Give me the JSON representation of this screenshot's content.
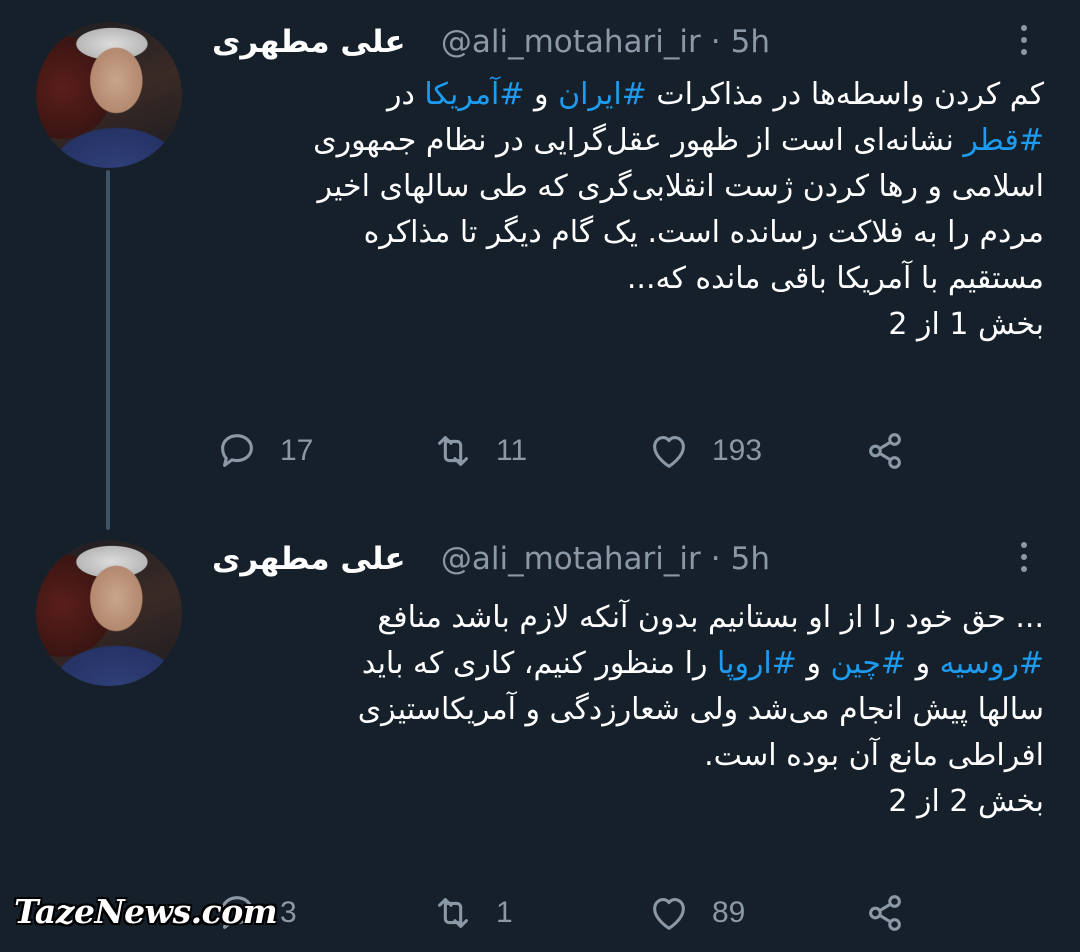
{
  "colors": {
    "background": "#15202b",
    "text": "#ffffff",
    "muted": "#8b98a5",
    "hashtag": "#1d9bf0"
  },
  "tweets": [
    {
      "name": "علی مطهری",
      "handle": "@ali_motahari_ir",
      "separator": "·",
      "time": "5h",
      "body": {
        "l1": {
          "a": "کم کردن واسطه‌ها در مذاکرات ",
          "t1": "#ایران",
          "b": " و ",
          "t2": "#آمریکا",
          "c": " در"
        },
        "l2": {
          "t1": "#قطر",
          "a": " نشانه‌ای است از ظهور عقل‌گرایی در نظام جمهوری"
        },
        "l3": "اسلامی و رها کردن ژست انقلابی‌گری که طی سالهای اخیر",
        "l4": "مردم را به فلاکت رسانده است. یک گام دیگر تا مذاکره",
        "l5": "مستقیم با آمریکا باقی مانده که...",
        "l6": "بخش 1 از 2"
      },
      "stats": {
        "replies": "17",
        "retweets": "11",
        "likes": "193"
      }
    },
    {
      "name": "علی مطهری",
      "handle": "@ali_motahari_ir",
      "separator": "·",
      "time": "5h",
      "body": {
        "l1": "... حق خود را از او بستانیم بدون آنکه لازم باشد منافع",
        "l2": {
          "t1": "#روسیه",
          "a": " و ",
          "t2": "#چین",
          "b": " و ",
          "t3": "#اروپا",
          "c": " را منظور کنیم، کاری که باید"
        },
        "l3": "سالها پیش انجام می‌شد ولی شعارزدگی و آمریکاستیزی",
        "l4": "افراطی مانع آن بوده است.",
        "l5": "بخش 2 از 2"
      },
      "stats": {
        "replies": "3",
        "retweets": "1",
        "likes": "89"
      }
    }
  ],
  "icons": {
    "reply": "reply-icon",
    "retweet": "retweet-icon",
    "like": "heart-icon",
    "share": "share-icon",
    "more": "more-vertical-icon"
  },
  "watermark": "TazeNews.com"
}
